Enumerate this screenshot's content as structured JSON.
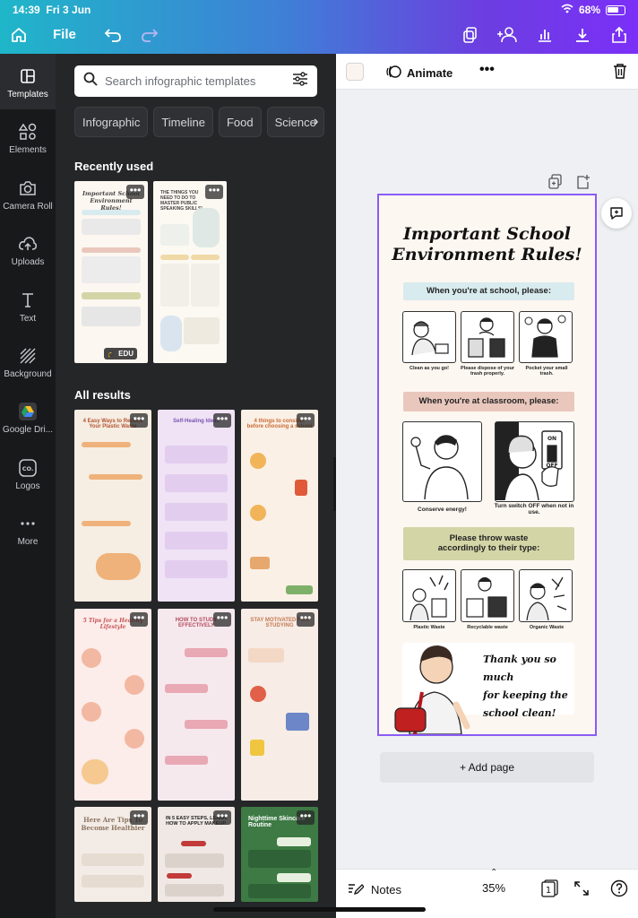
{
  "status_bar": {
    "time": "14:39",
    "date": "Fri 3 Jun",
    "battery": "68%"
  },
  "top_bar": {
    "file_label": "File"
  },
  "rail": {
    "items": [
      {
        "label": "Templates",
        "icon": "templates-icon",
        "active": true
      },
      {
        "label": "Elements",
        "icon": "elements-icon"
      },
      {
        "label": "Camera Roll",
        "icon": "camera-icon"
      },
      {
        "label": "Uploads",
        "icon": "upload-icon"
      },
      {
        "label": "Text",
        "icon": "text-icon"
      },
      {
        "label": "Background",
        "icon": "background-icon"
      },
      {
        "label": "Google Dri...",
        "icon": "google-drive-icon"
      },
      {
        "label": "Logos",
        "icon": "logos-icon"
      },
      {
        "label": "More",
        "icon": "more-icon"
      }
    ]
  },
  "panel": {
    "search_placeholder": "Search infographic templates",
    "chips": [
      "Infographic",
      "Timeline",
      "Food",
      "Science"
    ],
    "recently_used_title": "Recently used",
    "all_results_title": "All results",
    "recent": [
      {
        "title": "Important School Environment Rules!",
        "badge": "EDU"
      },
      {
        "title": "THE THINGS YOU NEED TO DO TO MASTER PUBLIC SPEAKING SKILLS!"
      }
    ],
    "results": [
      {
        "title": "4 Easy Ways to Reduce Your Plastic Waste",
        "bg": "#f6ede3"
      },
      {
        "title": "Self-Healing Ideas",
        "bg": "#efe3f5"
      },
      {
        "title": "4 things to consider before choosing a school",
        "bg": "#fbf0e6"
      },
      {
        "title": "5 Tips for a Healthy Lifestyle",
        "bg": "#fcecea"
      },
      {
        "title": "HOW TO STUDY EFFECTIVELY",
        "bg": "#f6e9ee"
      },
      {
        "title": "STAY MOTIVATED FOR STUDYING",
        "bg": "#f7ece6"
      },
      {
        "title": "Here Are Tips To Become Healthier",
        "bg": "#f3ece6"
      },
      {
        "title": "IN 5 EASY STEPS, LEARN HOW TO APPLY MAKEUP.",
        "bg": "#efe8e4"
      },
      {
        "title": "Nighttime Skincare Routine",
        "bg": "#3d7a44"
      }
    ]
  },
  "editor": {
    "animate_label": "Animate",
    "page": {
      "title_line1": "Important School",
      "title_line2": "Environment Rules!",
      "banner1": "When you're at school, please:",
      "captions1": [
        "Clean as you go!",
        "Please dispose of your trash properly.",
        "Pocket your small trash."
      ],
      "banner2": "When you're at classroom, please:",
      "captions2": [
        "Conserve energy!",
        "Turn switch OFF when not in use."
      ],
      "switch_on": "ON",
      "switch_off": "OFF",
      "banner3_line1": "Please throw waste",
      "banner3_line2": "accordingly to their type:",
      "captions3": [
        "Plastic Waste",
        "Recyclable waste",
        "Organic Waste"
      ],
      "thanks_lines": [
        "Thank you so much",
        "for keeping the",
        "school clean!"
      ]
    },
    "add_page_label": "+ Add page"
  },
  "bottom_bar": {
    "notes_label": "Notes",
    "zoom": "35%",
    "page_count": "1"
  },
  "colors": {
    "banner_blue": "#d8ebef",
    "banner_pink": "#e9c7bc",
    "banner_olive": "#d3d5a6",
    "selection": "#8b5cf6"
  }
}
